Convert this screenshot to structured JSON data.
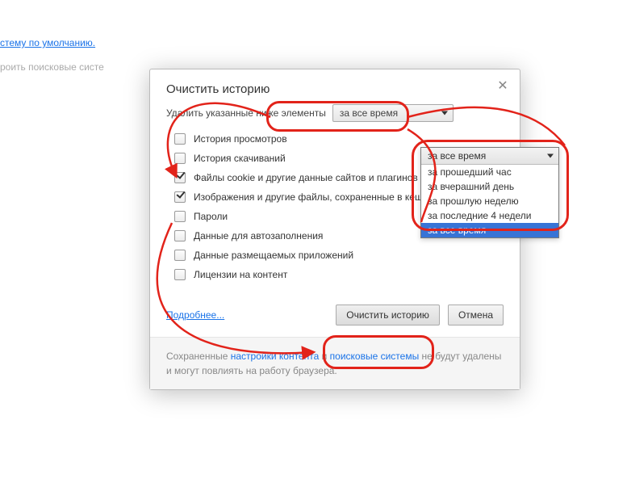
{
  "background": {
    "link1": "стему по умолчанию.",
    "text2": "роить поисковые систе"
  },
  "dialog": {
    "title": "Очистить историю",
    "delete_label": "Удалить указанные ниже элементы",
    "time_selected": "за все время",
    "time_options": [
      "за прошедший час",
      "за вчерашний день",
      "за прошлую неделю",
      "за последние 4 недели",
      "за все время"
    ],
    "items": [
      {
        "label": "История просмотров",
        "checked": false
      },
      {
        "label": "История скачиваний",
        "checked": false
      },
      {
        "label": "Файлы cookie и другие данные сайтов и плагинов",
        "checked": true
      },
      {
        "label": "Изображения и другие файлы, сохраненные в кеше",
        "checked": true
      },
      {
        "label": "Пароли",
        "checked": false
      },
      {
        "label": "Данные для автозаполнения",
        "checked": false
      },
      {
        "label": "Данные размещаемых приложений",
        "checked": false
      },
      {
        "label": "Лицензии на контент",
        "checked": false
      }
    ],
    "more_link": "Подробнее...",
    "btn_clear": "Очистить историю",
    "btn_cancel": "Отмена",
    "note_prefix": "Сохраненные ",
    "note_link1": "настройки контента",
    "note_mid": " и ",
    "note_link2": "поисковые системы",
    "note_suffix": " не будут удалены и могут повлиять на работу браузера."
  }
}
